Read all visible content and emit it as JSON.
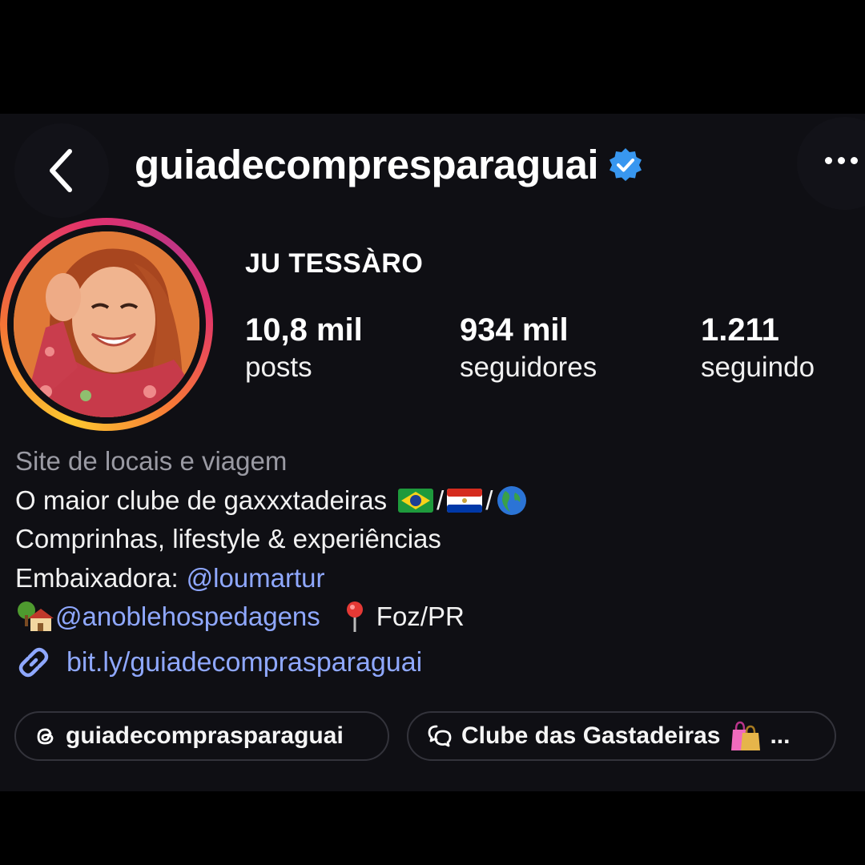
{
  "header": {
    "username": "guiadecompresparaguai",
    "verified": true,
    "accent_color": "#3897f0"
  },
  "profile": {
    "display_name": "JU TESSÀRO",
    "stats": [
      {
        "value": "10,8 mil",
        "label": "posts"
      },
      {
        "value": "934 mil",
        "label": "seguidores"
      },
      {
        "value": "1.211",
        "label": "seguindo"
      }
    ]
  },
  "bio": {
    "category": "Site de locais e viagem",
    "line1": "O maior clube de gaxxxtadeiras",
    "line1_sep1": "/",
    "line1_sep2": "/",
    "line2": "Comprinhas, lifestyle & experiências",
    "line3_prefix": "Embaixadora:",
    "line3_mention": "@loumartur",
    "line4_mention": "@anoblehospedagens",
    "line4_location": "Foz/PR",
    "link": "bit.ly/guiadecomprasparaguai",
    "link_color": "#8fa8ff"
  },
  "chips": [
    {
      "label": "guiadecomprasparaguai",
      "icon": "threads-icon"
    },
    {
      "label": "Clube das Gastadeiras",
      "icon": "channel-icon",
      "suffix": "..."
    }
  ],
  "icons": {
    "back": "chevron-left-icon",
    "more": "more-icon",
    "verified": "verified-badge-icon",
    "link": "link-icon",
    "flags": [
      "brazil-flag-icon",
      "paraguay-flag-icon",
      "globe-icon"
    ],
    "house": "house-tree-icon",
    "pin": "pin-icon",
    "bags": "shopping-bags-icon"
  }
}
